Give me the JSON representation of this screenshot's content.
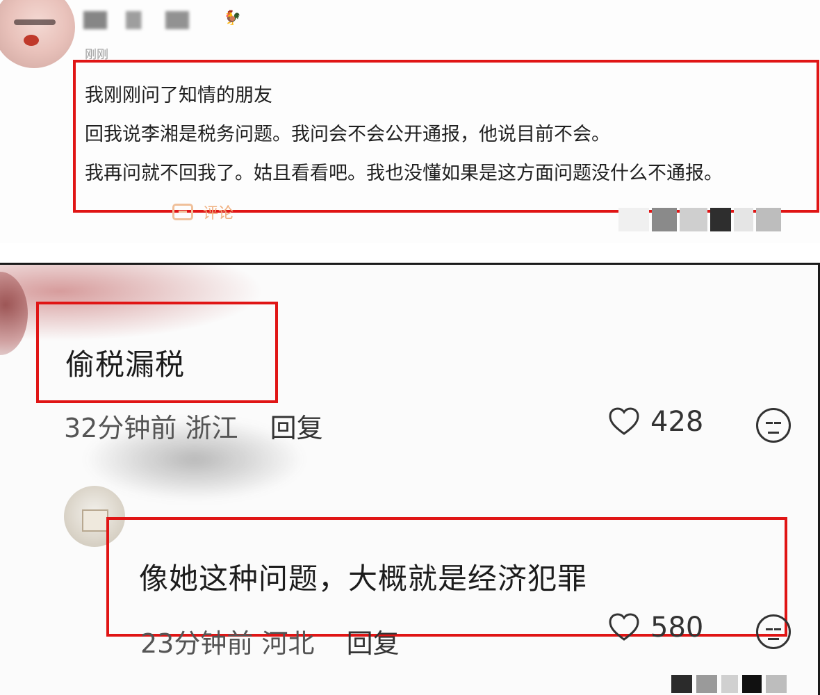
{
  "post": {
    "time": "刚刚",
    "lines": [
      "我刚刚问了知情的朋友",
      "回我说李湘是税务问题。我问会不会公开通报，他说目前不会。",
      "我再问就不回我了。姑且看看吧。我也没懂如果是这方面问题没什么不通报。"
    ],
    "comment_label": "评论",
    "badge_icon": "rooster-emoji-icon"
  },
  "comments": [
    {
      "text": "偷税漏税",
      "time": "32分钟前",
      "location": "浙江",
      "reply_label": "回复",
      "likes": "428"
    },
    {
      "text": "像她这种问题，大概就是经济犯罪",
      "time": "23分钟前",
      "location": "河北",
      "reply_label": "回复",
      "likes": "580"
    }
  ],
  "colors": {
    "highlight_box": "#e01515",
    "comment_accent": "#f0b080"
  }
}
